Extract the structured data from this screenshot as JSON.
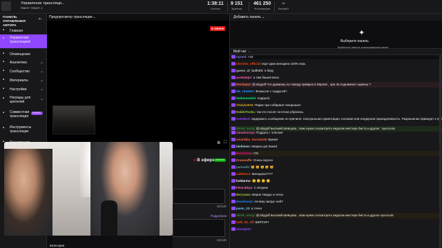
{
  "topbar": {
    "title": "Управление трансляци...",
    "subtitle": "Макет: Макет 1",
    "stats": [
      {
        "value": "1:38:11",
        "label": "Сессия"
      },
      {
        "value": "9 151",
        "label": "Зрители"
      },
      {
        "value": "461 250",
        "label": "Фолловеров"
      },
      {
        "value": "–",
        "label": "Битрейт"
      }
    ]
  },
  "sidebar": {
    "heading": "ПАНЕЛЬ УПРАВЛЕНИЯ АВТОРА",
    "items": [
      {
        "label": "Главная",
        "icon": "home-icon",
        "active": false,
        "chevron": false
      },
      {
        "label": "Управление трансляцией",
        "icon": "broadcast-icon",
        "active": true,
        "chevron": false
      },
      {
        "label": "Оповещения",
        "icon": "bell-icon",
        "active": false,
        "chevron": false
      },
      {
        "label": "Аналитика",
        "icon": "chart-icon",
        "active": false,
        "chevron": true
      },
      {
        "label": "Сообщество",
        "icon": "people-icon",
        "active": false,
        "chevron": true
      },
      {
        "label": "Материалы",
        "icon": "film-icon",
        "active": false,
        "chevron": true
      },
      {
        "label": "Настройки",
        "icon": "gear-icon",
        "active": false,
        "chevron": true
      },
      {
        "label": "Награды для зрителей",
        "icon": "gift-icon",
        "active": false,
        "chevron": true
      },
      {
        "label": "Совместная трансляция",
        "icon": "collab-icon",
        "active": false,
        "badge": "НОВОЕ",
        "chevron": false
      },
      {
        "label": "Инструменты трансляции",
        "icon": "tools-icon",
        "active": false,
        "chevron": false
      },
      {
        "label": "Расширения",
        "icon": "puzzle-icon",
        "active": false,
        "chevron": false
      }
    ]
  },
  "preview": {
    "header_label": "Предпросмотр трансляции",
    "live_badge": "В ЭФИРЕ"
  },
  "below_panel": {
    "live_label": "В эфире",
    "badge": "отлично",
    "count1": "31/140",
    "link": "Подробнее",
    "count2": "21/140",
    "bottom_label": "Категория"
  },
  "right_panel": {
    "add_panel": "Добавить панель",
    "select_title": "Выберите панель",
    "select_hint": "Выберите панель в выпадающем меню",
    "chat_title": "Мой чат"
  },
  "chat": [
    {
      "user": "nyxsol",
      "color": "#8a8aff",
      "text": "+15",
      "hl": ""
    },
    {
      "user": "cherries_official",
      "color": "#ff4500",
      "text": "еще одна женщина 100% игрь",
      "hl": ""
    },
    {
      "user": "guess_of_bullshit",
      "color": "#c9c9c9",
      "text": "я беру",
      "hl": ""
    },
    {
      "user": "yoshiakjsr",
      "color": "#ff69b4",
      "text": "а там башня веса",
      "hl": ""
    },
    {
      "user": "Rockspot",
      "color": "#ff7f50",
      "text": "@Jolygolf Что думаешь по поводу приврок в Европе , эри ли поднимают шумиху ?",
      "hl": "hl"
    },
    {
      "user": "NE_HUMMA",
      "color": "#1e90ff",
      "text": "Всмысле с подругой?",
      "hl": ""
    },
    {
      "user": "dodomustein",
      "color": "#00ff7f",
      "text": "подруге)",
      "hl": ""
    },
    {
      "user": "Vitalyk4934",
      "color": "#daa520",
      "text": "Парки три собиране покорошел",
      "hl": ""
    },
    {
      "user": "RabbitTosku",
      "color": "#9acd32",
      "text": "так это после тоготона убралась",
      "hl": ""
    },
    {
      "user": "AutoMod",
      "color": "#9147ff",
      "text": "Задержать сообщение по причине: Сексуальная ориентация, половая или гендерная принадлежность. Разрешение приведет к публикац",
      "hl": ""
    },
    {
      "user": "ahrek_nerzy",
      "color": "#2e8b57",
      "text": "@Jolygolf выгоняй Шевцова , Нам нужно посмотреть видосик мистера биста и других ' хуесосов",
      "hl": "hl2"
    },
    {
      "user": "cloudsnerya",
      "color": "#ff69b4",
      "text": "Подруга с членом!",
      "hl": ""
    },
    {
      "user": "smartbbs_hooob228",
      "color": "#ff6347",
      "text": "Время",
      "hl": ""
    },
    {
      "user": "idoltimes",
      "color": "#b0e0e6",
      "text": "Макрон got based",
      "hl": ""
    },
    {
      "user": "ExOdrmeu",
      "color": "#ff1493",
      "text": "OG",
      "hl": "hl3"
    },
    {
      "user": "Krasaraffe",
      "color": "#ff7f50",
      "text": "Очень вкусно",
      "hl": ""
    },
    {
      "user": "partnall2",
      "color": "#5f9ea0",
      "text": "🐱 🐱 🐱 🐱 🐱",
      "hl": ""
    },
    {
      "user": "sadhotov",
      "color": "#ff4500",
      "text": "Женщина????",
      "hl": ""
    },
    {
      "user": "holdarmo",
      "color": "#ffffff",
      "text": "😊 😊 😊 😊",
      "hl": ""
    },
    {
      "user": "FlexLikbyx",
      "color": "#ff69b4",
      "text": "С Игорем",
      "hl": ""
    },
    {
      "user": "Bмгузика",
      "color": "#9acd32",
      "text": "Верни твердо и четко",
      "hl": ""
    },
    {
      "user": "Hoveloast1",
      "color": "#1e90ff",
      "text": "почему засрус ней?",
      "hl": ""
    },
    {
      "user": "jaxon_23",
      "color": "#87cefa",
      "text": "а точка",
      "hl": ""
    },
    {
      "user": "ahrek_nerzy",
      "color": "#2e8b57",
      "text": "@Jolygolf выгоняй Шевцова , Нам нужно посмотреть видосик мистера биста и других хуесосов",
      "hl": "hl3"
    },
    {
      "user": "hulk_56_off",
      "color": "#ff4500",
      "text": "ШЕРСИЧ",
      "hl": ""
    },
    {
      "user": "Sbanghul",
      "color": "#9147ff",
      "text": "",
      "hl": ""
    }
  ]
}
